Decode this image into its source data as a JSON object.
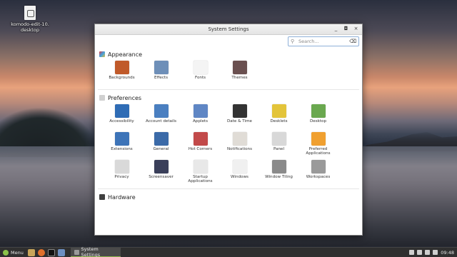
{
  "desktop": {
    "icon_label_line1": "komodo-edit-10.",
    "icon_label_line2": "desktop"
  },
  "window": {
    "title": "System Settings",
    "controls": [
      "_",
      "◘",
      "×"
    ],
    "search_placeholder": "Search..."
  },
  "sections": [
    {
      "name": "Appearance",
      "items": [
        {
          "label": "Backgrounds",
          "color": "#c05a2a"
        },
        {
          "label": "Effects",
          "color": "#6e8fb8"
        },
        {
          "label": "Fonts",
          "color": "#f4f4f4"
        },
        {
          "label": "Themes",
          "color": "#6a5050"
        }
      ]
    },
    {
      "name": "Preferences",
      "items": [
        {
          "label": "Accessibility",
          "color": "#2f6cb5"
        },
        {
          "label": "Account details",
          "color": "#4a7fc0"
        },
        {
          "label": "Applets",
          "color": "#5f86c4"
        },
        {
          "label": "Date & Time",
          "color": "#333333"
        },
        {
          "label": "Desklets",
          "color": "#e3c43a"
        },
        {
          "label": "Desktop",
          "color": "#6aa84f"
        },
        {
          "label": "Extensions",
          "color": "#3d74b8"
        },
        {
          "label": "General",
          "color": "#3b6aa8"
        },
        {
          "label": "Hot Corners",
          "color": "#c24a4a"
        },
        {
          "label": "Notifications",
          "color": "#e0dcd6"
        },
        {
          "label": "Panel",
          "color": "#d8d8d8"
        },
        {
          "label": "Preferred Applications",
          "color": "#f0a030"
        },
        {
          "label": "Privacy",
          "color": "#d9d9d9"
        },
        {
          "label": "Screensaver",
          "color": "#3a3f5a"
        },
        {
          "label": "Startup Applications",
          "color": "#e8e8e8"
        },
        {
          "label": "Windows",
          "color": "#f0f0f0"
        },
        {
          "label": "Window Tiling",
          "color": "#8a8a8a"
        },
        {
          "label": "Workspaces",
          "color": "#9a9a9a"
        }
      ]
    },
    {
      "name": "Hardware",
      "items": []
    }
  ],
  "panel": {
    "menu_label": "Menu",
    "task_label": "System Settings",
    "clock": "09:48"
  }
}
